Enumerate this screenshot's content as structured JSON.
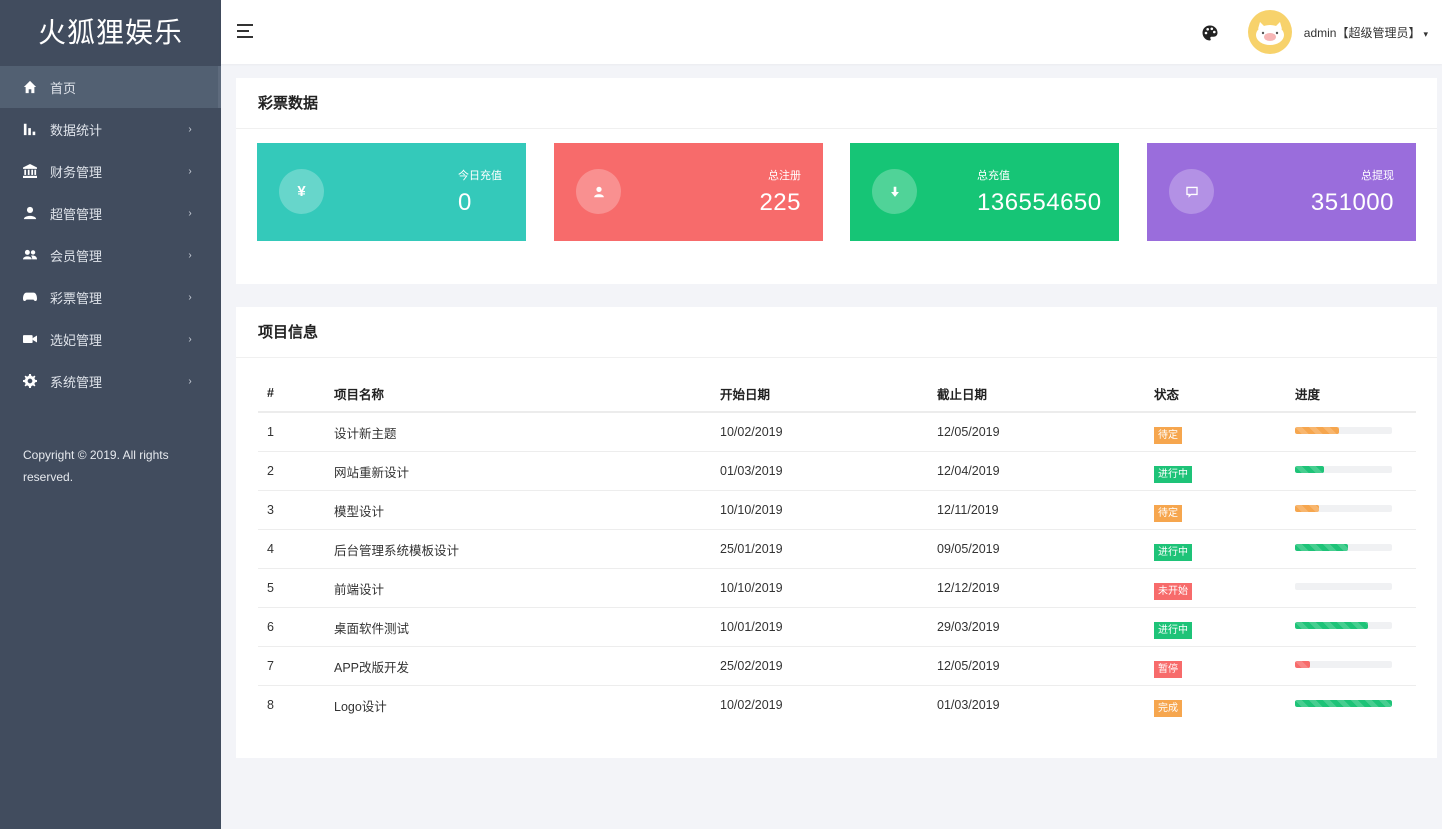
{
  "app": {
    "logo": "火狐狸娱乐"
  },
  "sidebar": {
    "items": [
      {
        "label": "首页",
        "icon": "home-icon",
        "arrow": ""
      },
      {
        "label": "数据统计",
        "icon": "bar-chart-icon",
        "arrow": "›"
      },
      {
        "label": "财务管理",
        "icon": "bank-icon",
        "arrow": "›"
      },
      {
        "label": "超管管理",
        "icon": "user-icon",
        "arrow": "›"
      },
      {
        "label": "会员管理",
        "icon": "users-icon",
        "arrow": "›"
      },
      {
        "label": "彩票管理",
        "icon": "gamepad-icon",
        "arrow": "›"
      },
      {
        "label": "选妃管理",
        "icon": "video-icon",
        "arrow": "›"
      },
      {
        "label": "系统管理",
        "icon": "gear-icon",
        "arrow": "›"
      }
    ],
    "copyright": "Copyright © 2019. All rights reserved."
  },
  "header": {
    "user_label": "admin【超级管理员】",
    "caret": "▾"
  },
  "stats_card": {
    "title": "彩票数据",
    "items": [
      {
        "label": "今日充值",
        "value": "0",
        "icon": "yen-icon",
        "color": "#34c9ba"
      },
      {
        "label": "总注册",
        "value": "225",
        "icon": "user-icon",
        "color": "#f76b6b"
      },
      {
        "label": "总充值",
        "value": "136554650",
        "icon": "download-icon",
        "color": "#16c576"
      },
      {
        "label": "总提现",
        "value": "351000",
        "icon": "message-icon",
        "color": "#9a6ddc"
      }
    ]
  },
  "project_card": {
    "title": "项目信息",
    "columns": [
      "#",
      "项目名称",
      "开始日期",
      "截止日期",
      "状态",
      "进度"
    ],
    "rows": [
      {
        "no": "1",
        "name": "设计新主题",
        "start": "10/02/2019",
        "end": "12/05/2019",
        "status": "待定",
        "status_color": "#f6a64e",
        "progress": 0.45,
        "progress_color": "#f6a64e"
      },
      {
        "no": "2",
        "name": "网站重新设计",
        "start": "01/03/2019",
        "end": "12/04/2019",
        "status": "进行中",
        "status_color": "#1ec378",
        "progress": 0.3,
        "progress_color": "#1ec378"
      },
      {
        "no": "3",
        "name": "模型设计",
        "start": "10/10/2019",
        "end": "12/11/2019",
        "status": "待定",
        "status_color": "#f6a64e",
        "progress": 0.25,
        "progress_color": "#f6a64e"
      },
      {
        "no": "4",
        "name": "后台管理系统模板设计",
        "start": "25/01/2019",
        "end": "09/05/2019",
        "status": "进行中",
        "status_color": "#1ec378",
        "progress": 0.55,
        "progress_color": "#1ec378"
      },
      {
        "no": "5",
        "name": "前端设计",
        "start": "10/10/2019",
        "end": "12/12/2019",
        "status": "未开始",
        "status_color": "#f76b6b",
        "progress": 0,
        "progress_color": "#f76b6b"
      },
      {
        "no": "6",
        "name": "桌面软件测试",
        "start": "10/01/2019",
        "end": "29/03/2019",
        "status": "进行中",
        "status_color": "#1ec378",
        "progress": 0.75,
        "progress_color": "#1ec378"
      },
      {
        "no": "7",
        "name": "APP改版开发",
        "start": "25/02/2019",
        "end": "12/05/2019",
        "status": "暂停",
        "status_color": "#f76b6b",
        "progress": 0.15,
        "progress_color": "#f76b6b"
      },
      {
        "no": "8",
        "name": "Logo设计",
        "start": "10/02/2019",
        "end": "01/03/2019",
        "status": "完成",
        "status_color": "#f6a64e",
        "progress": 1.0,
        "progress_color": "#1ec378"
      }
    ]
  }
}
